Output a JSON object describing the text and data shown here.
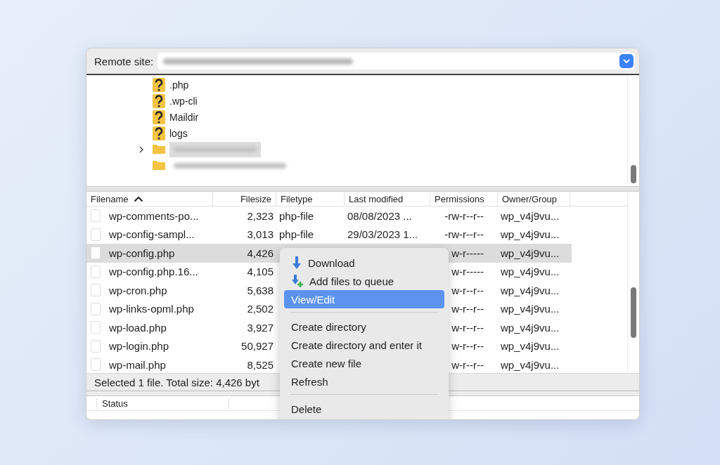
{
  "remote_site": {
    "label": "Remote site:"
  },
  "tree": [
    {
      "name": ".php",
      "kind": "unknown"
    },
    {
      "name": ".wp-cli",
      "kind": "unknown"
    },
    {
      "name": "Maildir",
      "kind": "unknown"
    },
    {
      "name": "logs",
      "kind": "unknown"
    },
    {
      "kind": "folder-collapsed",
      "selected": true
    },
    {
      "kind": "folder",
      "selected": false
    }
  ],
  "table": {
    "columns": [
      {
        "label": "Filename",
        "sorted": true
      },
      {
        "label": "Filesize",
        "sorted": false
      },
      {
        "label": "Filetype",
        "sorted": false
      },
      {
        "label": "Last modified",
        "sorted": false
      },
      {
        "label": "Permissions",
        "sorted": false
      },
      {
        "label": "Owner/Group",
        "sorted": false
      }
    ],
    "rows": [
      {
        "selected": false,
        "filename": "wp-comments-po...",
        "filesize": "2,323",
        "filetype": "php-file",
        "modified": "08/08/2023 ...",
        "permissions": "-rw-r--r--",
        "owner": "wp_v4j9vu..."
      },
      {
        "selected": false,
        "filename": "wp-config-sampl...",
        "filesize": "3,013",
        "filetype": "php-file",
        "modified": "29/03/2023 1...",
        "permissions": "-rw-r--r--",
        "owner": "wp_v4j9vu..."
      },
      {
        "selected": true,
        "filename": "wp-config.php",
        "filesize": "4,426",
        "permissions": "w-r-----",
        "owner": "wp_v4j9vu..."
      },
      {
        "selected": false,
        "filename": "wp-config.php.16...",
        "filesize": "4,105",
        "permissions": "w-r-----",
        "owner": "wp_v4j9vu..."
      },
      {
        "selected": false,
        "filename": "wp-cron.php",
        "filesize": "5,638",
        "permissions": "w-r--r--",
        "owner": "wp_v4j9vu..."
      },
      {
        "selected": false,
        "filename": "wp-links-opml.php",
        "filesize": "2,502",
        "permissions": "w-r--r--",
        "owner": "wp_v4j9vu..."
      },
      {
        "selected": false,
        "filename": "wp-load.php",
        "filesize": "3,927",
        "permissions": "w-r--r--",
        "owner": "wp_v4j9vu..."
      },
      {
        "selected": false,
        "filename": "wp-login.php",
        "filesize": "50,927",
        "permissions": "w-r--r--",
        "owner": "wp_v4j9vu..."
      },
      {
        "selected": false,
        "filename": "wp-mail.php",
        "filesize": "8,525",
        "permissions": "w-r--r--",
        "owner": "wp_v4j9vu..."
      }
    ]
  },
  "status_line": "Selected 1 file. Total size: 4,426 byt",
  "status_pane": {
    "heading": "Status"
  },
  "context_menu": [
    {
      "kind": "download",
      "label": "Download",
      "selected": false
    },
    {
      "kind": "queue",
      "label": "Add files to queue",
      "selected": false
    },
    {
      "kind": "item",
      "label": "View/Edit",
      "selected": true
    },
    {
      "kind": "separator"
    },
    {
      "kind": "item",
      "label": "Create directory",
      "selected": false
    },
    {
      "kind": "item",
      "label": "Create directory and enter it",
      "selected": false
    },
    {
      "kind": "item",
      "label": "Create new file",
      "selected": false
    },
    {
      "kind": "item",
      "label": "Refresh",
      "selected": false
    },
    {
      "kind": "separator"
    },
    {
      "kind": "item",
      "label": "Delete",
      "selected": false
    }
  ]
}
